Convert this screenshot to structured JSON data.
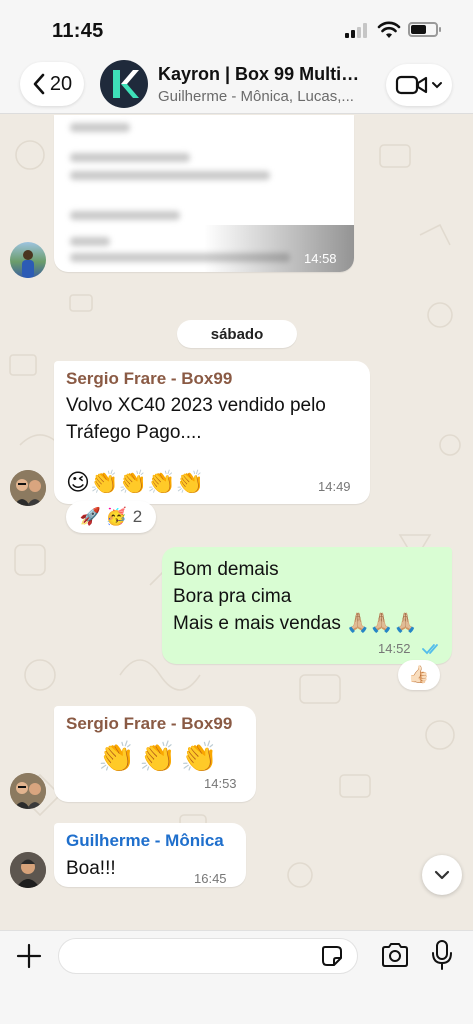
{
  "status_bar": {
    "time": "11:45"
  },
  "header": {
    "back_count": "20",
    "group_name": "Kayron | Box 99 Multim...",
    "members": "Guilherme - Mônica, Lucas,..."
  },
  "chat": {
    "day_separator": "sábado",
    "messages": [
      {
        "id": "m0",
        "type": "incoming",
        "content": "blurred document",
        "time": "14:58"
      },
      {
        "id": "m1",
        "type": "incoming",
        "sender": "Sergio Frare - Box99",
        "sender_color": "#8a5a44",
        "lines": [
          "Volvo XC40 2023 vendido pelo",
          "Tráfego Pago...."
        ],
        "emoji": "😉👏👏👏👏",
        "time": "14:49",
        "reaction": {
          "emojis": "🚀 🥳",
          "count": "2"
        }
      },
      {
        "id": "m2",
        "type": "outgoing",
        "lines": [
          "Bom demais",
          "Bora pra cima",
          "Mais e mais vendas 🙏🏼🙏🏼🙏🏼"
        ],
        "time": "14:52",
        "reaction": {
          "emojis": "👍🏻"
        }
      },
      {
        "id": "m3",
        "type": "incoming",
        "sender": "Sergio Frare - Box99",
        "sender_color": "#8a5a44",
        "emoji": "👏👏👏",
        "time": "14:53"
      },
      {
        "id": "m4",
        "type": "incoming",
        "sender": "Guilherme - Mônica",
        "sender_color": "#1f6fcc",
        "lines": [
          "Boa!!!"
        ],
        "time": "16:45"
      }
    ]
  },
  "composer": {
    "placeholder": ""
  },
  "colors": {
    "read_ticks": "#53bdeb",
    "outgoing_bubble": "#d9fdd3",
    "background": "#efeae2"
  }
}
